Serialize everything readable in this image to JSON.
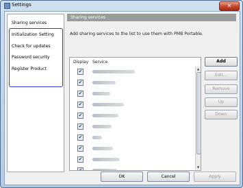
{
  "window": {
    "title": "Settings",
    "close_label": "✕"
  },
  "sidebar": {
    "items": [
      {
        "label": "Sharing services"
      },
      {
        "label": "Initialization Setting"
      },
      {
        "label": "Check for updates"
      },
      {
        "label": "Password security"
      },
      {
        "label": "Register Product"
      }
    ]
  },
  "panel": {
    "header": "Sharing services",
    "description": "Add sharing services to the list to use them with PMB Portable."
  },
  "table": {
    "columns": [
      "Display",
      "Service"
    ],
    "rows": [
      {
        "checked": true,
        "check_glyph": "✔",
        "service": ""
      },
      {
        "checked": true,
        "check_glyph": "✔",
        "service": ""
      },
      {
        "checked": true,
        "check_glyph": "✔",
        "service": ""
      },
      {
        "checked": true,
        "check_glyph": "✔",
        "service": ""
      },
      {
        "checked": true,
        "check_glyph": "✔",
        "service": ""
      },
      {
        "checked": true,
        "check_glyph": "✔",
        "service": ""
      },
      {
        "checked": true,
        "check_glyph": "✔",
        "service": ""
      },
      {
        "checked": true,
        "check_glyph": "✔",
        "service": ""
      },
      {
        "checked": true,
        "check_glyph": "✔",
        "service": ""
      },
      {
        "checked": true,
        "check_glyph": "✔",
        "service": ""
      }
    ],
    "scroll_up_glyph": "▲",
    "scroll_down_glyph": "▼"
  },
  "actions": {
    "add": "Add",
    "edit": "Edit...",
    "remove": "Remove",
    "up": "Up",
    "down": "Down"
  },
  "footer": {
    "ok": "OK",
    "cancel": "Cancel",
    "apply": "Apply"
  }
}
